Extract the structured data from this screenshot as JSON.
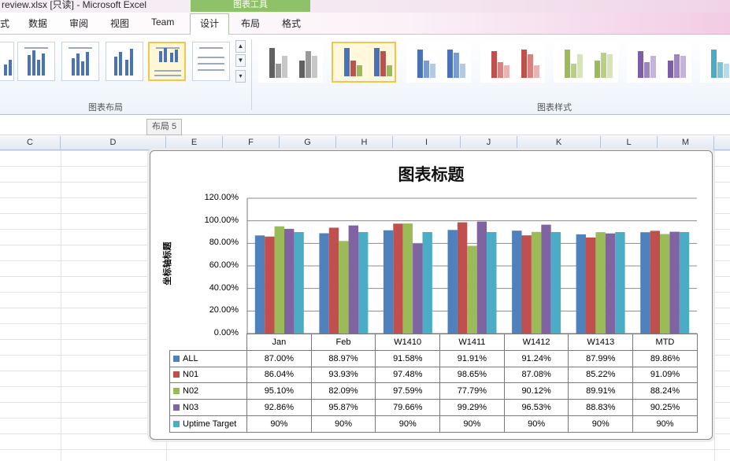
{
  "window": {
    "title": "review.xlsx [只读] - Microsoft Excel",
    "tool_group": "图表工具"
  },
  "tabs": [
    {
      "label": "式"
    },
    {
      "label": "数据"
    },
    {
      "label": "审阅"
    },
    {
      "label": "视图"
    },
    {
      "label": "Team"
    },
    {
      "label": "设计",
      "active": true
    },
    {
      "label": "布局"
    },
    {
      "label": "格式"
    }
  ],
  "ribbon": {
    "group_layout_label": "图表布局",
    "group_styles_label": "图表样式",
    "tooltip": "布局 5"
  },
  "columns": [
    "C",
    "D",
    "E",
    "F",
    "G",
    "H",
    "I",
    "J",
    "K",
    "L",
    "M"
  ],
  "styles": {
    "palettes": [
      [
        "#606060",
        "#9a9a9a",
        "#c7c7c7"
      ],
      [
        "#4a72b8",
        "#c0504d",
        "#9bbb59"
      ],
      [
        "#4a72b8",
        "#7a9cd0",
        "#b5c8e6"
      ],
      [
        "#c0504d",
        "#d8817f",
        "#ebb4b3"
      ],
      [
        "#9bbb59",
        "#b9d084",
        "#d6e4b8"
      ],
      [
        "#7b5ea5",
        "#9d86c0",
        "#c3b5da"
      ],
      [
        "#4bacc6",
        "#7cc3d6",
        "#b2dde9"
      ]
    ]
  },
  "chart_data": {
    "type": "bar",
    "title": "图表标题",
    "ylabel": "坐标轴标题",
    "xlabel": "",
    "categories": [
      "Jan",
      "Feb",
      "W1410",
      "W1411",
      "W1412",
      "W1413",
      "MTD"
    ],
    "ylim": [
      0,
      120
    ],
    "yticks": [
      "0.00%",
      "20.00%",
      "40.00%",
      "60.00%",
      "80.00%",
      "100.00%",
      "120.00%"
    ],
    "grid": true,
    "legend": "data-table",
    "series": [
      {
        "name": "ALL",
        "color": "#4f81bd",
        "values": [
          87.0,
          88.97,
          91.58,
          91.91,
          91.24,
          87.99,
          89.86
        ],
        "labels": [
          "87.00%",
          "88.97%",
          "91.58%",
          "91.91%",
          "91.24%",
          "87.99%",
          "89.86%"
        ]
      },
      {
        "name": "N01",
        "color": "#c0504d",
        "values": [
          86.04,
          93.93,
          97.48,
          98.65,
          87.08,
          85.22,
          91.09
        ],
        "labels": [
          "86.04%",
          "93.93%",
          "97.48%",
          "98.65%",
          "87.08%",
          "85.22%",
          "91.09%"
        ]
      },
      {
        "name": "N02",
        "color": "#9bbb59",
        "values": [
          95.1,
          82.09,
          97.59,
          77.79,
          90.12,
          89.91,
          88.24
        ],
        "labels": [
          "95.10%",
          "82.09%",
          "97.59%",
          "77.79%",
          "90.12%",
          "89.91%",
          "88.24%"
        ]
      },
      {
        "name": "N03",
        "color": "#8064a2",
        "values": [
          92.86,
          95.87,
          79.66,
          99.29,
          96.53,
          88.83,
          90.25
        ],
        "labels": [
          "92.86%",
          "95.87%",
          "79.66%",
          "99.29%",
          "96.53%",
          "88.83%",
          "90.25%"
        ]
      },
      {
        "name": "Uptime Target",
        "color": "#4bacc6",
        "values": [
          90,
          90,
          90,
          90,
          90,
          90,
          90
        ],
        "labels": [
          "90%",
          "90%",
          "90%",
          "90%",
          "90%",
          "90%",
          "90%"
        ]
      }
    ]
  }
}
